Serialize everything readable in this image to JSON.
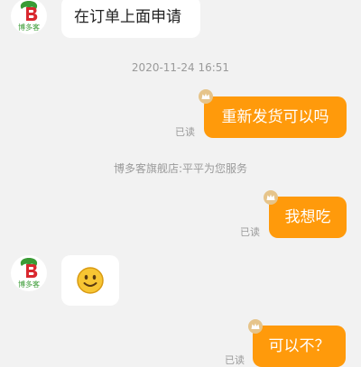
{
  "shop": {
    "avatar_logo_text": "博多客",
    "avatar_logo_letter": "B"
  },
  "messages": {
    "m1_text": "在订单上面申请",
    "timestamp": "2020-11-24 16:51",
    "m2_text": "重新发货可以吗",
    "m2_status": "已读",
    "system_notice": "博多客旗舰店:平平为您服务",
    "m3_text": "我想吃",
    "m3_status": "已读",
    "m4_emoji": "smiley-face",
    "m5_text": "可以不？",
    "m5_status": "已读"
  },
  "colors": {
    "outgoing_bubble": "#ff9a0b",
    "incoming_bubble": "#ffffff",
    "background": "#f2f2f2",
    "logo_green": "#3a9b35",
    "logo_red": "#d9282f"
  }
}
